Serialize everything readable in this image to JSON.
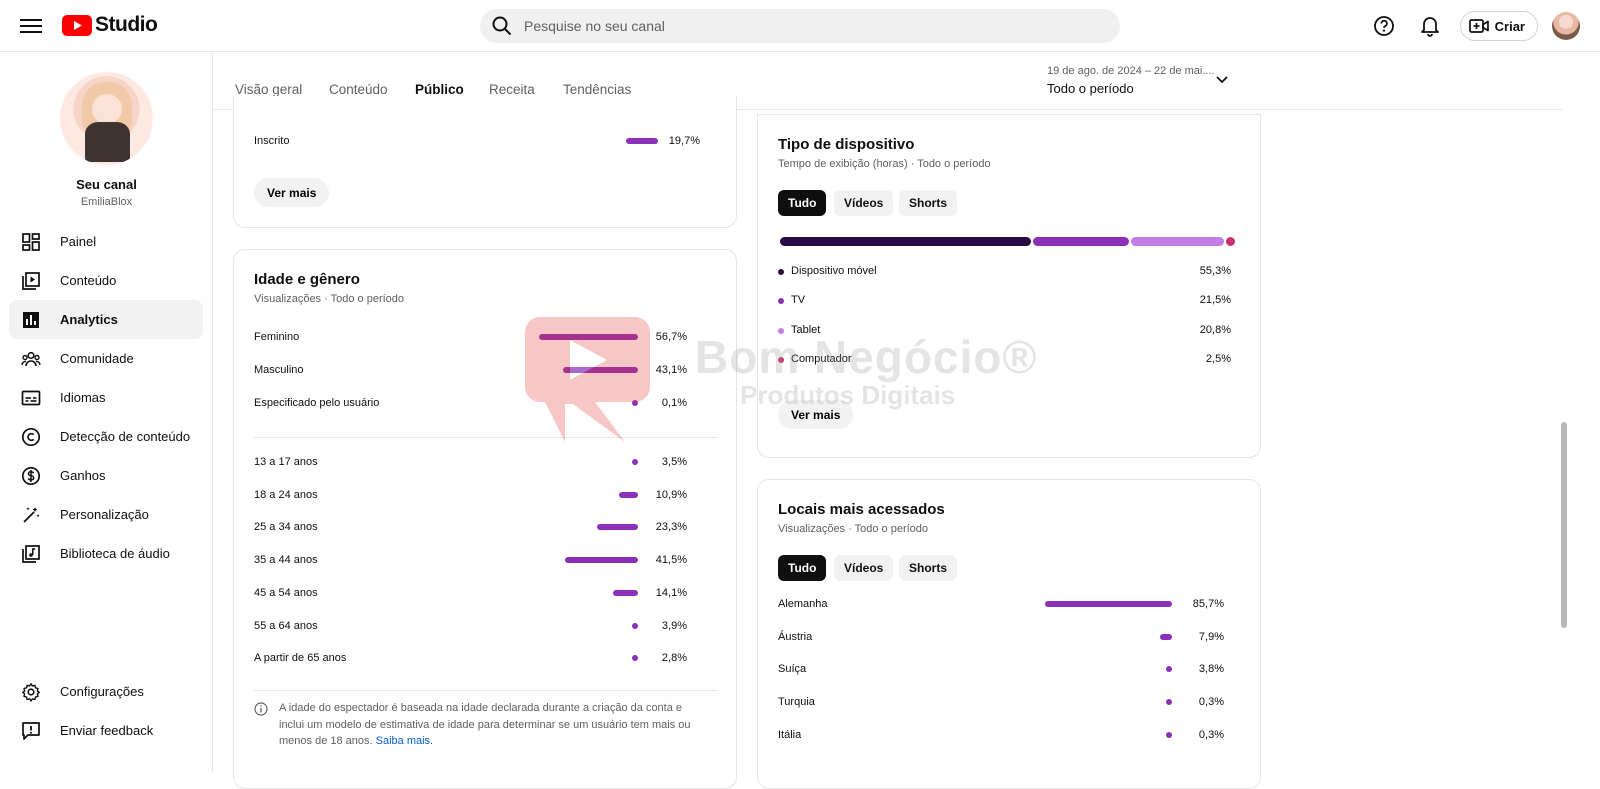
{
  "app": {
    "logo_text": "Studio"
  },
  "search": {
    "placeholder": "Pesquise no seu canal"
  },
  "topbar": {
    "create_label": "Criar"
  },
  "channel": {
    "name": "Seu canal",
    "handle": "EmiliaBlox"
  },
  "sidebar": {
    "items": [
      {
        "label": "Painel",
        "icon": "dashboard-icon"
      },
      {
        "label": "Conteúdo",
        "icon": "content-icon"
      },
      {
        "label": "Analytics",
        "icon": "analytics-icon",
        "active": true
      },
      {
        "label": "Comunidade",
        "icon": "community-icon"
      },
      {
        "label": "Idiomas",
        "icon": "subtitles-icon"
      },
      {
        "label": "Detecção de conteúdo",
        "icon": "copyright-icon"
      },
      {
        "label": "Ganhos",
        "icon": "dollar-icon"
      },
      {
        "label": "Personalização",
        "icon": "magic-wand-icon"
      },
      {
        "label": "Biblioteca de áudio",
        "icon": "audio-library-icon"
      }
    ],
    "bottom": [
      {
        "label": "Configurações",
        "icon": "gear-icon"
      },
      {
        "label": "Enviar feedback",
        "icon": "feedback-icon"
      }
    ]
  },
  "tabs": [
    {
      "label": "Visão geral"
    },
    {
      "label": "Conteúdo"
    },
    {
      "label": "Público",
      "active": true
    },
    {
      "label": "Receita"
    },
    {
      "label": "Tendências"
    }
  ],
  "period": {
    "range": "19 de ago. de 2024 – 22 de mai....",
    "label": "Todo o período"
  },
  "subscription_card": {
    "row": {
      "label": "Inscrito",
      "value": "19,7%",
      "fraction": 0.197
    },
    "more_button": "Ver mais"
  },
  "age_gender": {
    "title": "Idade e gênero",
    "subtitle": "Visualizações · Todo o período",
    "gender": [
      {
        "label": "Feminino",
        "value": "56,7%",
        "fraction": 0.567
      },
      {
        "label": "Masculino",
        "value": "43,1%",
        "fraction": 0.431
      },
      {
        "label": "Especificado pelo usuário",
        "value": "0,1%",
        "fraction": 0.001
      }
    ],
    "ages": [
      {
        "label": "13 a 17 anos",
        "value": "3,5%",
        "fraction": 0.035
      },
      {
        "label": "18 a 24 anos",
        "value": "10,9%",
        "fraction": 0.109
      },
      {
        "label": "25 a 34 anos",
        "value": "23,3%",
        "fraction": 0.233
      },
      {
        "label": "35 a 44 anos",
        "value": "41,5%",
        "fraction": 0.415
      },
      {
        "label": "45 a 54 anos",
        "value": "14,1%",
        "fraction": 0.141
      },
      {
        "label": "55 a 64 anos",
        "value": "3,9%",
        "fraction": 0.039
      },
      {
        "label": "A partir de 65 anos",
        "value": "2,8%",
        "fraction": 0.028
      }
    ],
    "note_text": "A idade do espectador é baseada na idade declarada durante a criação da conta e inclui um modelo de estimativa de idade para determinar se um usuário tem mais ou menos de 18 anos.",
    "note_link": "Saiba mais."
  },
  "device": {
    "title": "Tipo de dispositivo",
    "subtitle": "Tempo de exibição (horas) · Todo o período",
    "chips": [
      "Tudo",
      "Vídeos",
      "Shorts"
    ],
    "items": [
      {
        "label": "Dispositivo móvel",
        "value": "55,3%",
        "fraction": 0.553,
        "color": "#2a0a45"
      },
      {
        "label": "TV",
        "value": "21,5%",
        "fraction": 0.215,
        "color": "#8e2fb8"
      },
      {
        "label": "Tablet",
        "value": "20,8%",
        "fraction": 0.208,
        "color": "#c37ce8"
      },
      {
        "label": "Computador",
        "value": "2,5%",
        "fraction": 0.025,
        "color": "#cc2f6e"
      }
    ],
    "more_button": "Ver mais"
  },
  "locations": {
    "title": "Locais mais acessados",
    "subtitle": "Visualizações · Todo o período",
    "chips": [
      "Tudo",
      "Vídeos",
      "Shorts"
    ],
    "items": [
      {
        "label": "Alemanha",
        "value": "85,7%",
        "fraction": 0.857
      },
      {
        "label": "Áustria",
        "value": "7,9%",
        "fraction": 0.079
      },
      {
        "label": "Suíça",
        "value": "3,8%",
        "fraction": 0.038
      },
      {
        "label": "Turquia",
        "value": "0,3%",
        "fraction": 0.003
      },
      {
        "label": "Itália",
        "value": "0,3%",
        "fraction": 0.003
      }
    ]
  },
  "watermark": {
    "line1": "Bom Negócio®",
    "line2": "Produtos Digitais"
  },
  "colors": {
    "accent": "#8e2fb8",
    "link": "#065fd4",
    "brand_red": "#ff0000"
  }
}
